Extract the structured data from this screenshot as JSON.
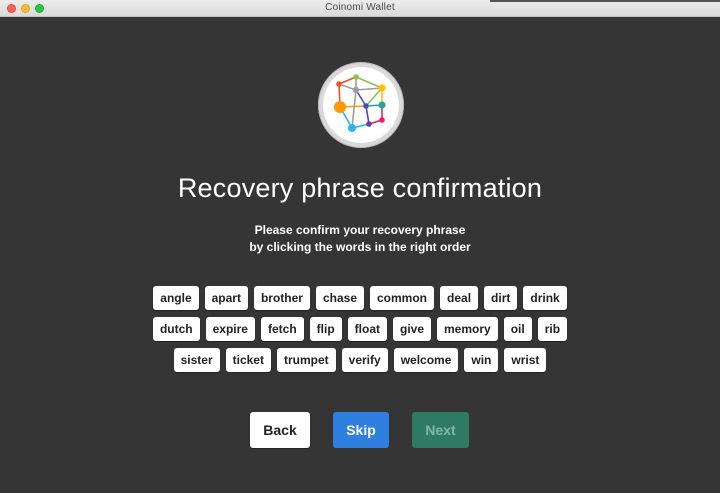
{
  "window": {
    "title": "Coinomi Wallet"
  },
  "logo": {
    "icon": "coinomi-network-logo-icon"
  },
  "heading": "Recovery phrase confirmation",
  "subtitle": {
    "line1": "Please confirm your recovery phrase",
    "line2": "by clicking the words in the right order"
  },
  "word_rows": [
    [
      "angle",
      "apart",
      "brother",
      "chase",
      "common",
      "deal",
      "dirt",
      "drink"
    ],
    [
      "dutch",
      "expire",
      "fetch",
      "flip",
      "float",
      "give",
      "memory",
      "oil",
      "rib"
    ],
    [
      "sister",
      "ticket",
      "trumpet",
      "verify",
      "welcome",
      "win",
      "wrist"
    ]
  ],
  "buttons": {
    "back": "Back",
    "skip": "Skip",
    "next": "Next"
  },
  "colors": {
    "background": "#353535",
    "skip": "#2f7fe0",
    "next_disabled": "#2f7a63"
  }
}
